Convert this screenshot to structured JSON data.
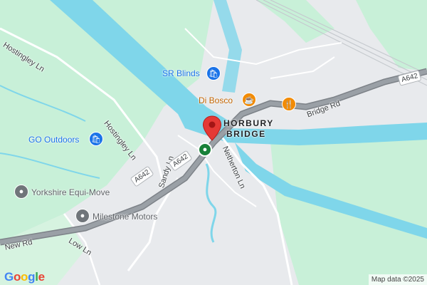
{
  "map": {
    "colors": {
      "land": "#e8eaed",
      "green": "#c8f0d8",
      "water": "#7fd6ea",
      "road": "#9aa0a6",
      "road_edge": "#7d8288",
      "minor_road": "#ffffff",
      "pin_red": "#e53935",
      "poi_blue": "#1a73e8",
      "poi_orange": "#f28b06",
      "poi_grey": "#70757a",
      "station_green": "#188038"
    },
    "place": "HORBURY\nBRIDGE",
    "place_line1": "HORBURY",
    "place_line2": "BRIDGE",
    "roads": {
      "hostingley_top": "Hostingley Ln",
      "hostingley_mid": "Hostingley Ln",
      "sandy_ln": "Sandy Ln",
      "netherton_ln": "Netherton Ln",
      "bridge_rd": "Bridge Rd",
      "new_rd": "New Rd",
      "low_ln": "Low Ln",
      "a642_left": "A642",
      "a642_mid": "A642",
      "a642_right": "A642"
    },
    "pois": {
      "sr_blinds": "SR Blinds",
      "di_bosco": "Di Bosco",
      "go_outdoors": "GO Outdoors",
      "yorkshire_equi_move": "Yorkshire Equi-Move",
      "milestone_motors": "Milestone Motors"
    },
    "icons": {
      "shopping": "shopping-bag-icon",
      "cafe": "coffee-cup-icon",
      "restaurant": "fork-knife-icon",
      "generic": "generic-place-icon",
      "station": "train-station-icon",
      "marker": "location-pin-icon"
    },
    "logo": "Google",
    "attribution": "Map data ©2025"
  }
}
